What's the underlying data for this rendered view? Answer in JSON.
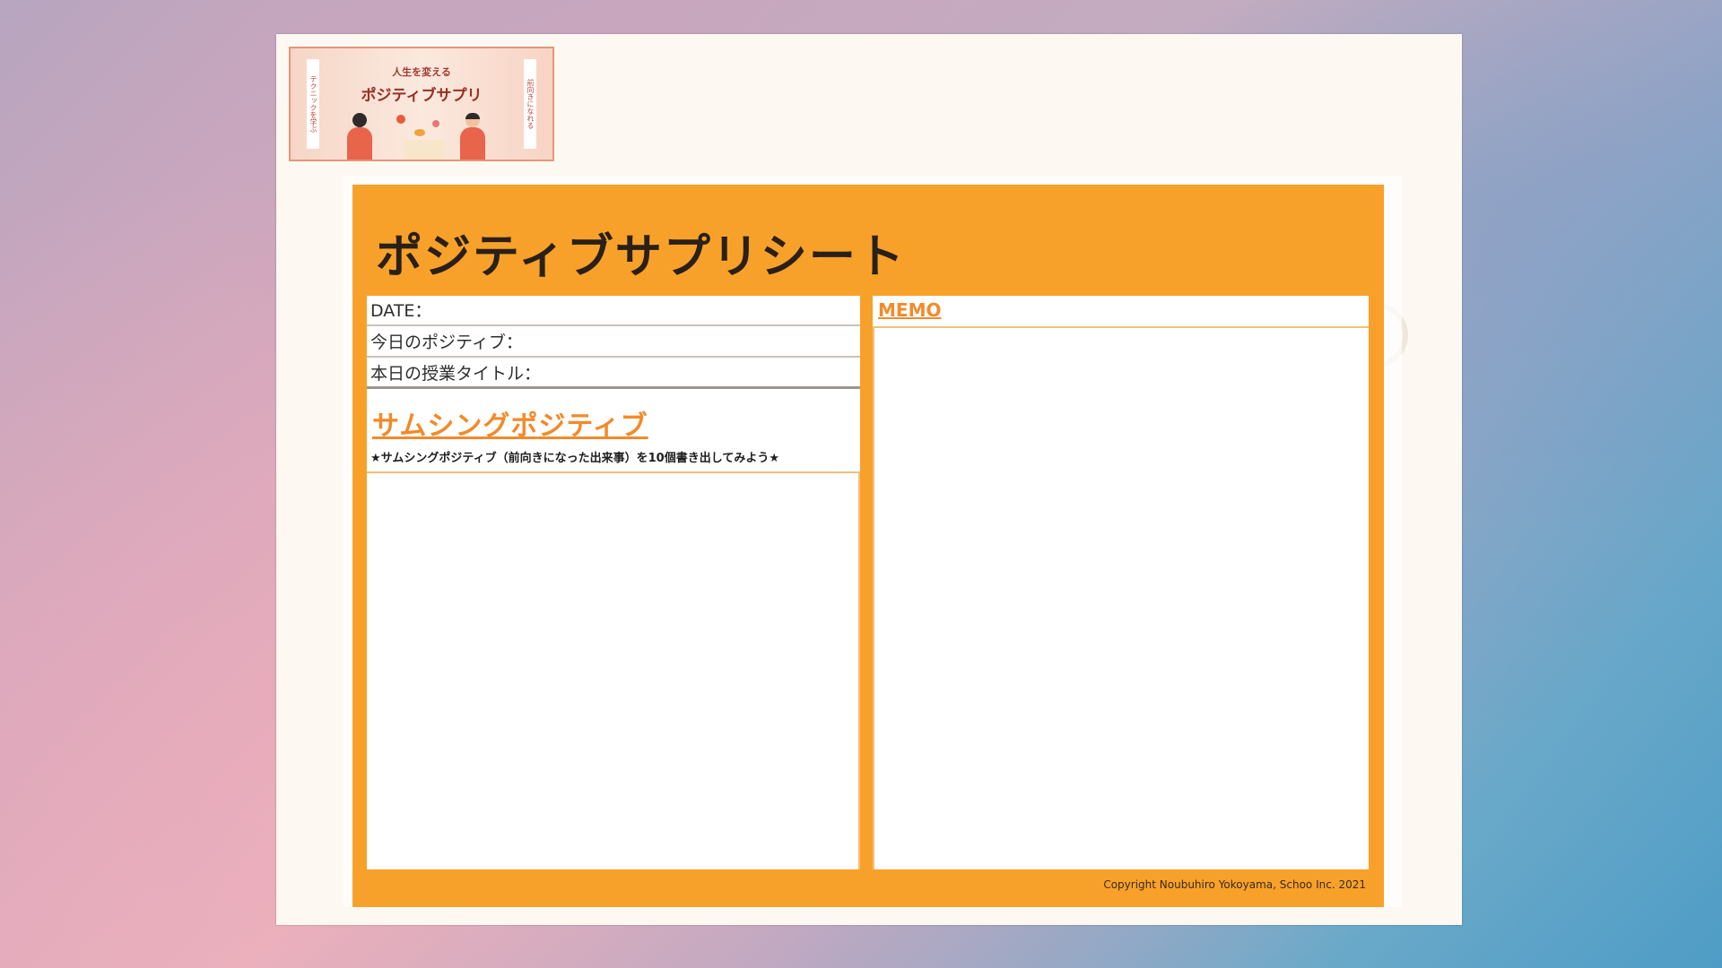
{
  "banner": {
    "kicker": "人生を変える",
    "title": "ポジティブサプリ",
    "side_left": "テクニックを学ぶ",
    "side_right": "前向きになれる"
  },
  "sheet": {
    "title": "ポジティブサプリシート",
    "fields": {
      "date": "DATE：",
      "positive": "今日のポジティブ：",
      "lesson": "本日の授業タイトル："
    },
    "section_heading": "サムシングポジティブ",
    "instruction": "★サムシングポジティブ（前向きになった出来事）を10個書き出してみよう★",
    "memo_label": "MEMO",
    "copyright": "Copyright Noubuhiro Yokoyama, Schoo Inc. 2021"
  },
  "colors": {
    "sheet_orange": "#f8a12a",
    "heading_orange": "#f28a2a"
  }
}
